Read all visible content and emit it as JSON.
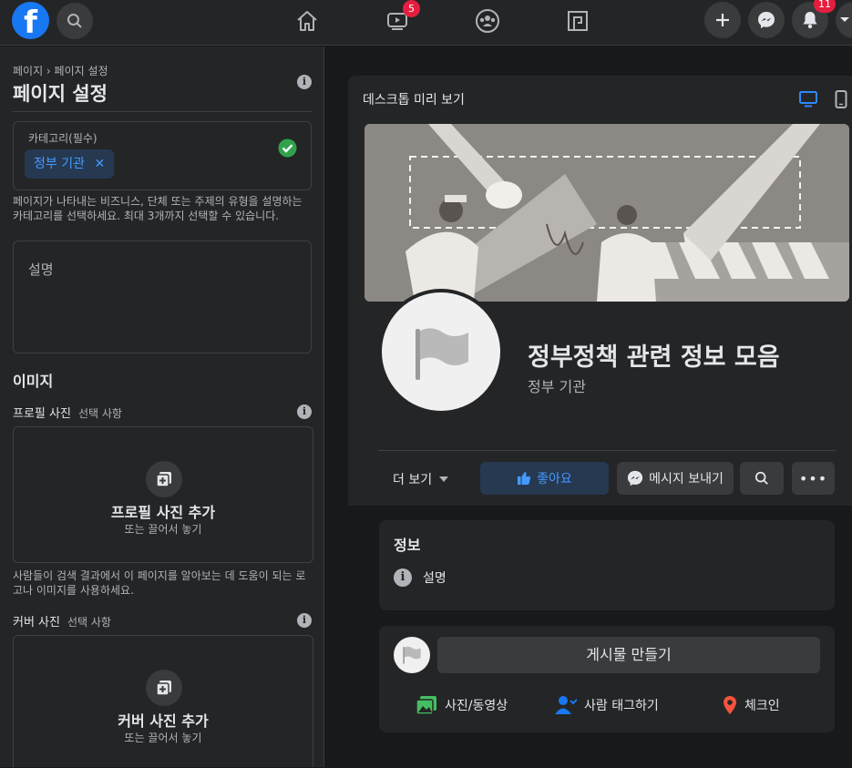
{
  "topbar": {
    "logo": "f",
    "notifications_badge": "11",
    "video_badge": "5",
    "icons": [
      "search-icon",
      "home-icon",
      "video-icon",
      "groups-icon",
      "gaming-icon",
      "plus-icon",
      "messenger-icon",
      "bell-icon",
      "caret-down-icon"
    ]
  },
  "left": {
    "breadcrumb": "페이지 › 페이지 설정",
    "title": "페이지 설정",
    "category_label": "카테고리(필수)",
    "category_chip": "정부 기관",
    "category_help": "페이지가 나타내는 비즈니스, 단체 또는 주제의 유형을 설명하는 카테고리를 선택하세요. 최대 3개까지 선택할 수 있습니다.",
    "description_placeholder": "설명",
    "images_heading": "이미지",
    "profile_label": "프로필 사진",
    "profile_optional": "선택 사항",
    "profile_add": "프로필 사진 추가",
    "profile_drag": "또는 끌어서 놓기",
    "profile_help": "사람들이 검색 결과에서 이 페이지를 알아보는 데 도움이 되는 로고나 이미지를 사용하세요.",
    "cover_label": "커버 사진",
    "cover_optional": "선택 사항",
    "cover_add": "커버 사진 추가",
    "cover_drag": "또는 끌어서 놓기"
  },
  "preview": {
    "title": "데스크톱 미리 보기",
    "page_name": "정부정책 관련 정보 모음",
    "page_category": "정부 기관",
    "more_label": "더 보기",
    "like_label": "좋아요",
    "message_label": "메시지 보내기",
    "info_heading": "정보",
    "info_description": "설명",
    "create_post": "게시물 만들기",
    "photo_video": "사진/동영상",
    "tag_people": "사람 태그하기",
    "checkin": "체크인"
  },
  "colors": {
    "accent": "#1877f2",
    "success": "#31a24c",
    "badge": "#e41e3f"
  }
}
